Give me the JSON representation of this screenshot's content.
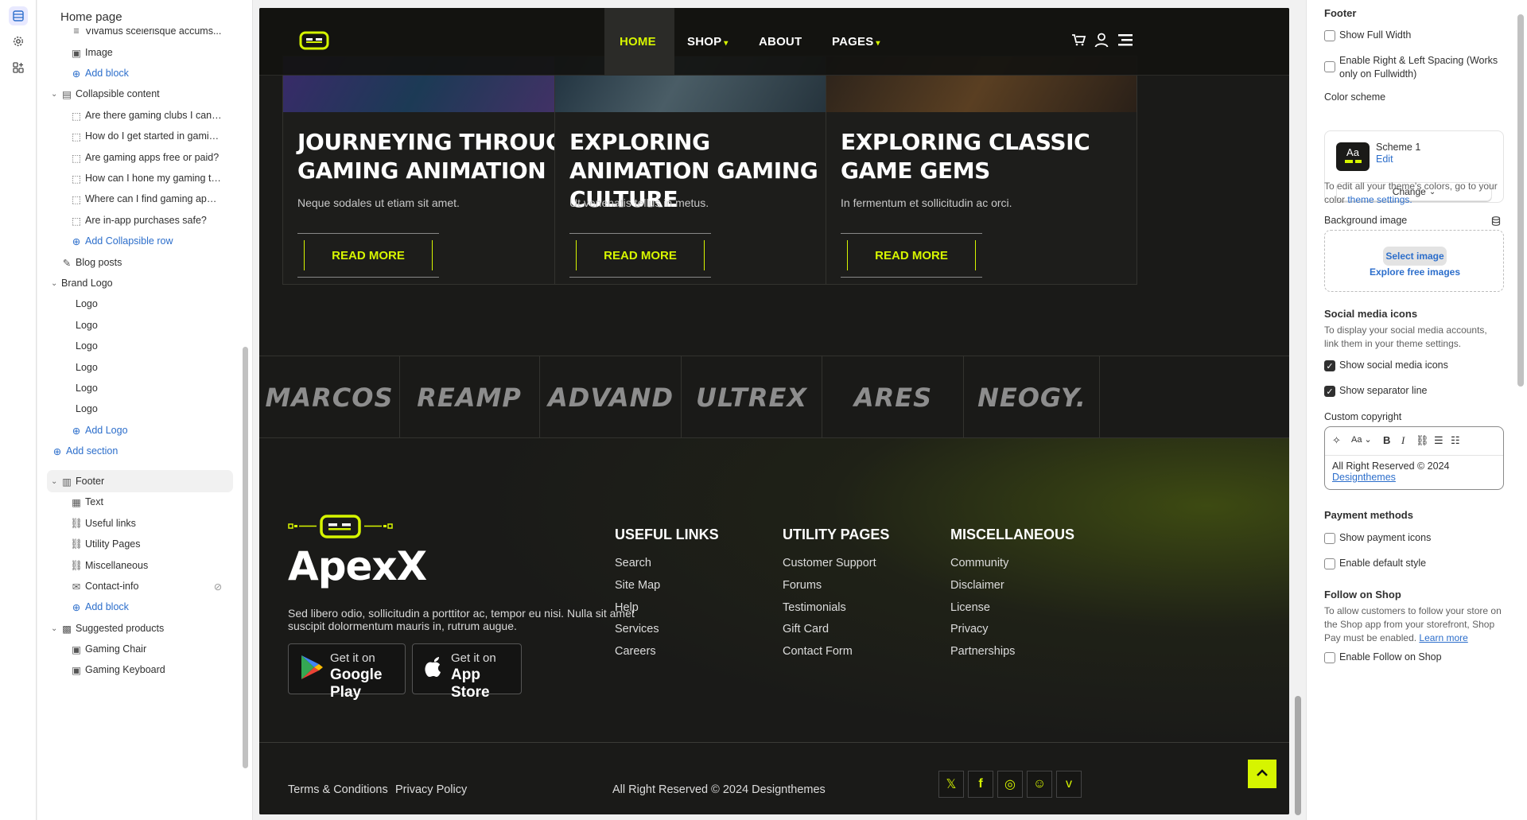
{
  "sidebar": {
    "title": "Home page",
    "items": [
      {
        "label": "Vivamus scelerisque accums..."
      },
      {
        "label": "Image"
      },
      {
        "label": "Add block"
      },
      {
        "label": "Collapsible content"
      },
      {
        "label": "Are there gaming clubs I can j..."
      },
      {
        "label": "How do I get started in gaming?"
      },
      {
        "label": "Are gaming apps free or paid?"
      },
      {
        "label": "How can I hone my gaming ta..."
      },
      {
        "label": "Where can I find gaming apps?"
      },
      {
        "label": "Are in-app purchases safe?"
      },
      {
        "label": "Add Collapsible row"
      },
      {
        "label": "Blog posts"
      },
      {
        "label": "Brand Logo"
      },
      {
        "label": "Logo"
      },
      {
        "label": "Logo"
      },
      {
        "label": "Logo"
      },
      {
        "label": "Logo"
      },
      {
        "label": "Logo"
      },
      {
        "label": "Logo"
      },
      {
        "label": "Add Logo"
      },
      {
        "label": "Add section"
      },
      {
        "label": "Footer"
      },
      {
        "label": "Text"
      },
      {
        "label": "Useful links"
      },
      {
        "label": "Utility Pages"
      },
      {
        "label": "Miscellaneous"
      },
      {
        "label": "Contact-info"
      },
      {
        "label": "Add block"
      },
      {
        "label": "Suggested products"
      },
      {
        "label": "Gaming Chair"
      },
      {
        "label": "Gaming Keyboard"
      }
    ]
  },
  "site": {
    "nav": {
      "links": [
        "HOME",
        "SHOP",
        "ABOUT",
        "PAGES"
      ],
      "icons": [
        "cart-icon",
        "user-icon",
        "menu-icon"
      ]
    },
    "cards": [
      {
        "title": "JOURNEYING THROUGH GAMING ANIMATION",
        "desc": "Neque sodales ut etiam sit amet.",
        "cta": "READ MORE"
      },
      {
        "title": "EXPLORING ANIMATION GAMING CULTURE",
        "desc": "Ut venenatis tellus in metus.",
        "cta": "READ MORE"
      },
      {
        "title": "EXPLORING CLASSIC GAME GEMS",
        "desc": "In fermentum et sollicitudin ac orci.",
        "cta": "READ MORE"
      }
    ],
    "brands": [
      "MARCOS",
      "REAMP",
      "ADVAND",
      "ULTREX",
      "ARES",
      "NEOGY."
    ],
    "footer": {
      "brand": "ApexX",
      "desc": "Sed libero odio, sollicitudin a porttitor ac, tempor eu nisi. Nulla sit amet suscipit dolormentum mauris in, rutrum augue.",
      "google": {
        "top": "Get it on",
        "bottom": "Google Play"
      },
      "apple": {
        "top": "Get it on",
        "bottom": "App Store"
      },
      "columns": [
        {
          "heading": "USEFUL LINKS",
          "links": [
            "Search",
            "Site Map",
            "Help",
            "Services",
            "Careers"
          ]
        },
        {
          "heading": "UTILITY PAGES",
          "links": [
            "Customer Support",
            "Forums",
            "Testimonials",
            "Gift Card",
            "Contact Form"
          ]
        },
        {
          "heading": "MISCELLANEOUS",
          "links": [
            "Community",
            "Disclaimer",
            "License",
            "Privacy",
            "Partnerships"
          ]
        }
      ],
      "terms": "Terms & Conditions",
      "privacy": "Privacy Policy",
      "copyright": "All Right Reserved © 2024 Designthemes",
      "social": [
        "x-icon",
        "facebook-icon",
        "instagram-icon",
        "snapchat-icon",
        "vimeo-icon"
      ]
    },
    "accent": "#d6f500"
  },
  "settings": {
    "section": "Footer",
    "show_full_width": "Show Full Width",
    "enable_spacing": "Enable Right & Left Spacing (Works only on Fullwidth)",
    "color_scheme_label": "Color scheme",
    "scheme_name": "Scheme 1",
    "scheme_edit": "Edit",
    "scheme_swatch": "Aa",
    "change": "Change",
    "colors_help_a": "To edit all your theme's colors, go to your color ",
    "colors_help_link": "theme settings.",
    "bg_image_label": "Background image",
    "select_image": "Select image",
    "explore_images": "Explore free images",
    "social_heading": "Social media icons",
    "social_help": "To display your social media accounts, link them in your theme settings.",
    "show_social": "Show social media icons",
    "show_separator": "Show separator line",
    "copyright_label": "Custom copyright",
    "copyright_text": "All Right Reserved © 2024",
    "copyright_link": "Designthemes",
    "payment_heading": "Payment methods",
    "show_payment": "Show payment icons",
    "default_style": "Enable default style",
    "follow_heading": "Follow on Shop",
    "follow_help": "To allow customers to follow your store on the Shop app from your storefront, Shop Pay must be enabled.",
    "learn_more": "Learn more",
    "enable_follow": "Enable Follow on Shop",
    "checkboxes": {
      "show_full_width": false,
      "enable_spacing": false,
      "show_social": true,
      "show_separator": true,
      "show_payment": false,
      "default_style": false,
      "enable_follow": false
    }
  }
}
